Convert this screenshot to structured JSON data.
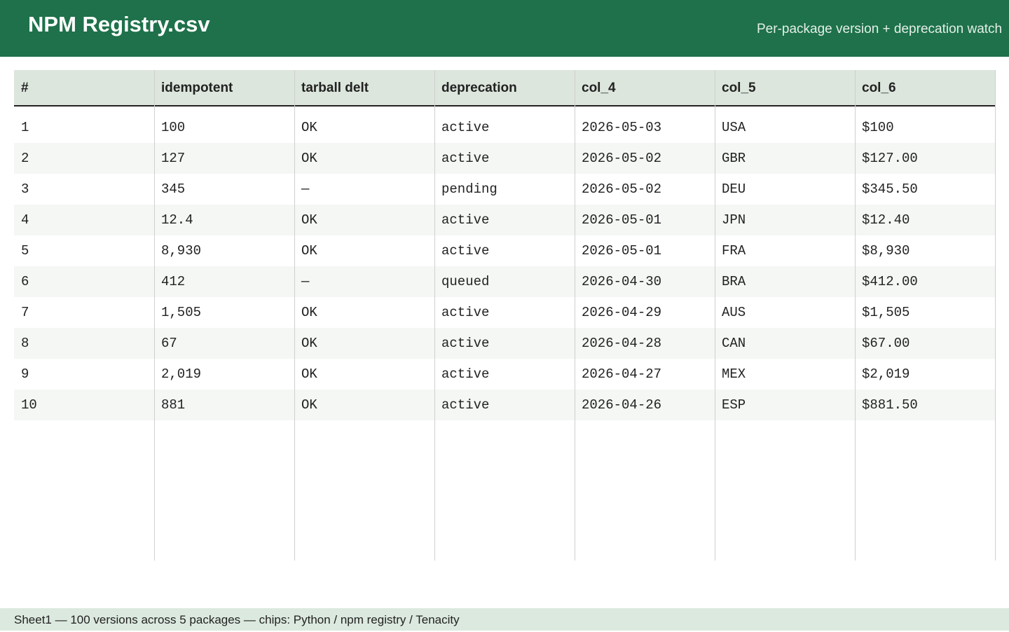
{
  "header": {
    "title": "NPM Registry.csv",
    "subtitle": "Per-package version + deprecation watch"
  },
  "table": {
    "columns": [
      "#",
      "idempotent",
      "tarball delt",
      "deprecation",
      "col_4",
      "col_5",
      "col_6"
    ],
    "rows": [
      [
        "1",
        "100",
        "OK",
        "active",
        "2026-05-03",
        "USA",
        "$100"
      ],
      [
        "2",
        "127",
        "OK",
        "active",
        "2026-05-02",
        "GBR",
        "$127.00"
      ],
      [
        "3",
        "345",
        "—",
        "pending",
        "2026-05-02",
        "DEU",
        "$345.50"
      ],
      [
        "4",
        "12.4",
        "OK",
        "active",
        "2026-05-01",
        "JPN",
        "$12.40"
      ],
      [
        "5",
        "8,930",
        "OK",
        "active",
        "2026-05-01",
        "FRA",
        "$8,930"
      ],
      [
        "6",
        "412",
        "—",
        "queued",
        "2026-04-30",
        "BRA",
        "$412.00"
      ],
      [
        "7",
        "1,505",
        "OK",
        "active",
        "2026-04-29",
        "AUS",
        "$1,505"
      ],
      [
        "8",
        "67",
        "OK",
        "active",
        "2026-04-28",
        "CAN",
        "$67.00"
      ],
      [
        "9",
        "2,019",
        "OK",
        "active",
        "2026-04-27",
        "MEX",
        "$2,019"
      ],
      [
        "10",
        "881",
        "OK",
        "active",
        "2026-04-26",
        "ESP",
        "$881.50"
      ]
    ]
  },
  "footer": {
    "status": "Sheet1 — 100 versions across 5 packages — chips: Python / npm registry / Tenacity"
  }
}
